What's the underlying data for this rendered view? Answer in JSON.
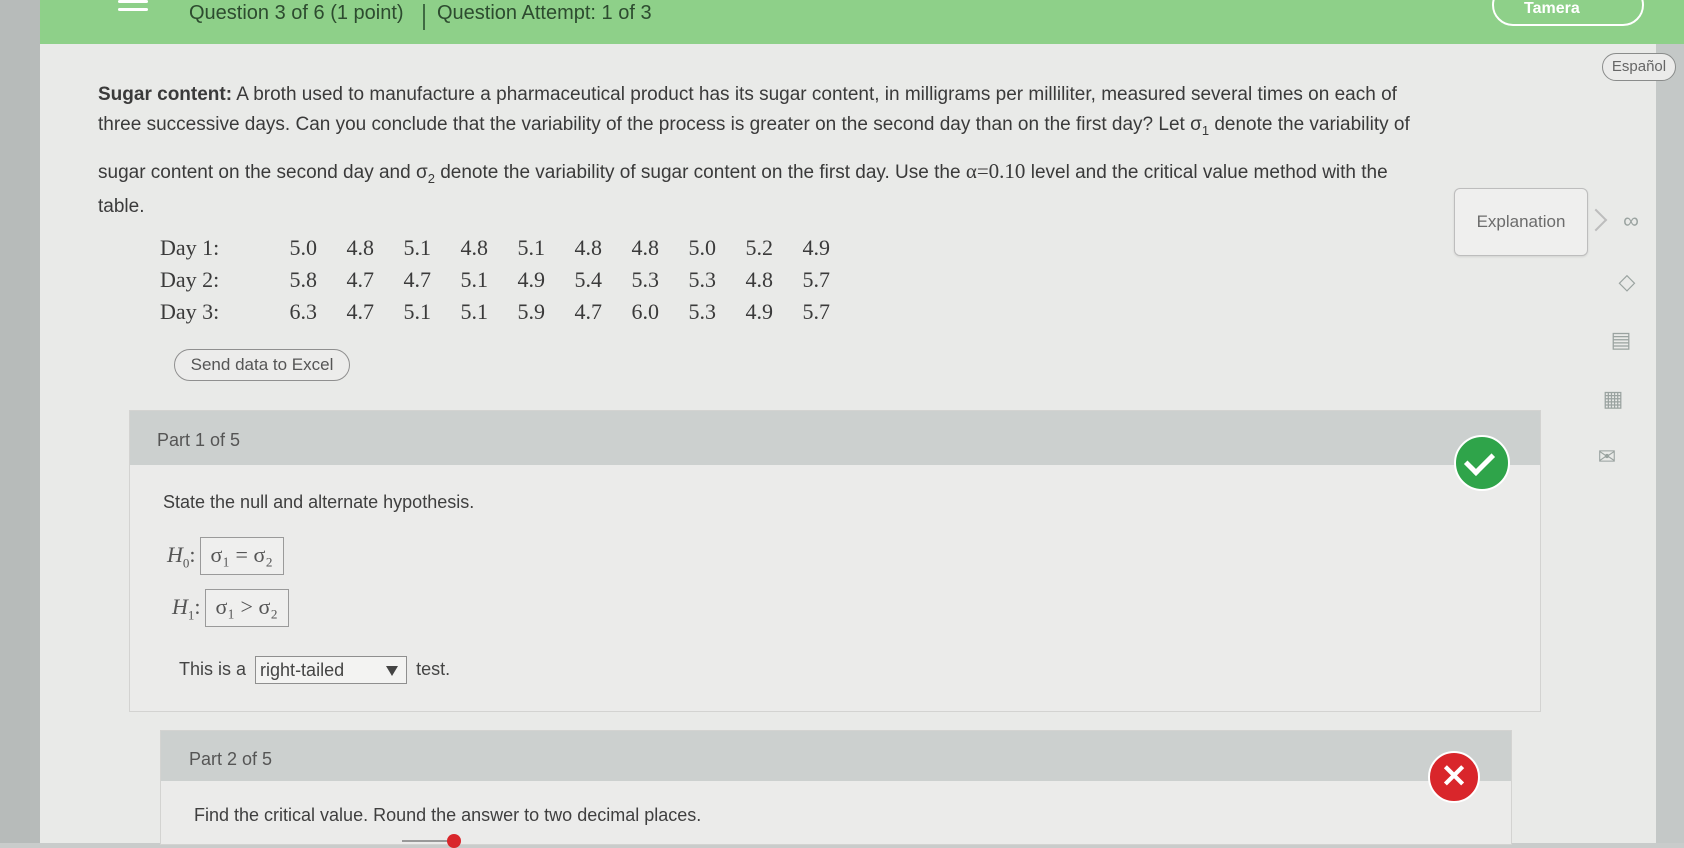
{
  "header": {
    "question_info": "Question 3 of 6 (1 point)",
    "attempt_info": "Question Attempt: 1 of 3",
    "top_right_label": "Tamera"
  },
  "language_button": "Español",
  "problem": {
    "topic": "Sugar content:",
    "line1": "A broth used to manufacture a pharmaceutical product has its sugar content, in milligrams per milliliter, measured several times on each of",
    "line2a": "three successive days. Can you conclude that the variability of the process is greater on the second day than on the first day? Let σ",
    "line2_sub": "1",
    "line2b": " denote the variability of",
    "line3a": "sugar content on the second day and σ",
    "line3_sub": "2",
    "line3b": " denote the variability of sugar content on the first day. Use the ",
    "alpha": "α=0.10",
    "line3c": " level and the critical value method with the",
    "line4": "table."
  },
  "explanation_button": "Explanation",
  "data_table": [
    {
      "label": "Day 1:",
      "values": [
        "5.0",
        "4.8",
        "5.1",
        "4.8",
        "5.1",
        "4.8",
        "4.8",
        "5.0",
        "5.2",
        "4.9"
      ]
    },
    {
      "label": "Day 2:",
      "values": [
        "5.8",
        "4.7",
        "4.7",
        "5.1",
        "4.9",
        "5.4",
        "5.3",
        "5.3",
        "4.8",
        "5.7"
      ]
    },
    {
      "label": "Day 3:",
      "values": [
        "6.3",
        "4.7",
        "5.1",
        "5.1",
        "5.9",
        "4.7",
        "6.0",
        "5.3",
        "4.9",
        "5.7"
      ]
    }
  ],
  "excel_button": "Send data to Excel",
  "part1": {
    "title": "Part 1 of 5",
    "status": "correct",
    "instruction": "State the null and alternate hypothesis.",
    "h0_label": "H",
    "h0_sub": "0",
    "h0_expr": "σ₁ = σ₂",
    "h1_label": "H",
    "h1_sub": "1",
    "h1_expr": "σ₁ > σ₂",
    "tail_prefix": "This is a",
    "tail_value": "right-tailed",
    "tail_suffix": "test."
  },
  "part2": {
    "title": "Part 2 of 5",
    "status": "incorrect",
    "instruction": "Find the critical value. Round the answer to two decimal places."
  },
  "side_icons": [
    "infinity-icon",
    "tag-icon",
    "notes-icon",
    "calculator-icon",
    "mail-icon"
  ],
  "colors": {
    "header_green": "#8ed089",
    "correct_green": "#2fa44a",
    "incorrect_red": "#d9262b"
  }
}
